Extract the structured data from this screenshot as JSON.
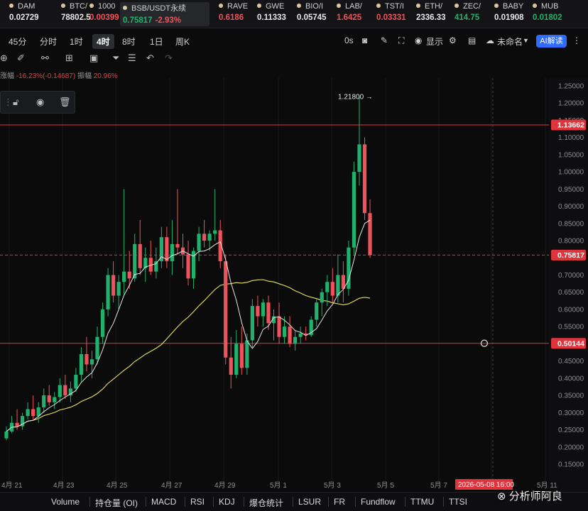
{
  "ticker": [
    {
      "name": "DAM",
      "price": "0.02729",
      "color": "w"
    },
    {
      "name": "BTC/",
      "price": "78802.5",
      "color": "w"
    },
    {
      "name": "1000",
      "price": "0.00399",
      "color": "r"
    },
    {
      "name": "BSB/USDT永续",
      "price": "0.75817",
      "change": "-2.93%",
      "color": "g",
      "active": true
    },
    {
      "name": "RAVE",
      "price": "0.6186",
      "color": "r"
    },
    {
      "name": "GWE",
      "price": "0.11333",
      "color": "w"
    },
    {
      "name": "BIO/I",
      "price": "0.05745",
      "color": "w"
    },
    {
      "name": "LAB/",
      "price": "1.6425",
      "color": "r"
    },
    {
      "name": "TST/I",
      "price": "0.03331",
      "color": "r"
    },
    {
      "name": "ETH/",
      "price": "2336.33",
      "color": "w"
    },
    {
      "name": "ZEC/",
      "price": "414.75",
      "color": "g"
    },
    {
      "name": "BABY",
      "price": "0.01908",
      "color": "w"
    },
    {
      "name": "MUB",
      "price": "0.01802",
      "color": "g"
    }
  ],
  "timeframes": [
    "45分",
    "分时",
    "1时",
    "4时",
    "8时",
    "1日",
    "周K"
  ],
  "active_timeframe": "4时",
  "toolbar": {
    "zero_label": "0s",
    "display_label": "显示",
    "layout_name": "未命名",
    "ai_label": "AI解读"
  },
  "stats": {
    "change_label": "涨幅",
    "change_value": "-16.23%(-0.14687)",
    "amp_label": "振幅",
    "amp_value": "20.96%"
  },
  "indicators": [
    "Volume",
    "持仓量 (OI)",
    "MACD",
    "RSI",
    "KDJ",
    "爆仓统计",
    "LSUR",
    "FR",
    "Fundflow",
    "TTMU",
    "TTSI"
  ],
  "watermark": "⊗ 分析师阿良",
  "colors": {
    "up": "#20b26c",
    "down": "#f0525a",
    "ma_short": "#e6e6e6",
    "ma_long": "#e8e25a",
    "hline": "#e0343c",
    "ai": "#2f6bff"
  },
  "chart_data": {
    "type": "candlestick",
    "interval": "4h",
    "ylim": [
      0.15,
      1.27
    ],
    "y_ticks": [
      1.25,
      1.2,
      1.15,
      1.1,
      1.05,
      1.0,
      0.95,
      0.9,
      0.85,
      0.8,
      0.75,
      0.7,
      0.65,
      0.6,
      0.55,
      0.5,
      0.45,
      0.4,
      0.35,
      0.3,
      0.25,
      0.2,
      0.15
    ],
    "x_labels": [
      "4月 21",
      "4月 23",
      "4月 25",
      "4月 27",
      "4月 29",
      "5月 1",
      "5月 3",
      "5月 5",
      "5月 7",
      "5月 11"
    ],
    "cursor_label": "2026-05-08 16:00",
    "price_lines": [
      {
        "value": 1.13662,
        "label": "1.13662",
        "style": "solid"
      },
      {
        "value": 0.75817,
        "label": "0.75817",
        "style": "dashed"
      },
      {
        "value": 0.50144,
        "label": "0.50144",
        "style": "solid"
      }
    ],
    "high_marker": {
      "value": 1.218,
      "label": "1.21800 →"
    },
    "candles": [
      [
        0.225,
        0.26,
        0.22,
        0.245
      ],
      [
        0.245,
        0.29,
        0.24,
        0.27
      ],
      [
        0.27,
        0.31,
        0.25,
        0.26
      ],
      [
        0.26,
        0.3,
        0.25,
        0.29
      ],
      [
        0.29,
        0.33,
        0.28,
        0.31
      ],
      [
        0.31,
        0.35,
        0.28,
        0.29
      ],
      [
        0.29,
        0.33,
        0.27,
        0.315
      ],
      [
        0.315,
        0.37,
        0.3,
        0.35
      ],
      [
        0.35,
        0.38,
        0.32,
        0.33
      ],
      [
        0.33,
        0.36,
        0.31,
        0.345
      ],
      [
        0.345,
        0.4,
        0.33,
        0.38
      ],
      [
        0.38,
        0.41,
        0.34,
        0.35
      ],
      [
        0.35,
        0.39,
        0.33,
        0.37
      ],
      [
        0.37,
        0.43,
        0.36,
        0.41
      ],
      [
        0.41,
        0.49,
        0.39,
        0.47
      ],
      [
        0.47,
        0.52,
        0.42,
        0.44
      ],
      [
        0.44,
        0.48,
        0.4,
        0.455
      ],
      [
        0.455,
        0.55,
        0.44,
        0.52
      ],
      [
        0.52,
        0.62,
        0.5,
        0.6
      ],
      [
        0.6,
        0.72,
        0.58,
        0.7
      ],
      [
        0.7,
        0.74,
        0.62,
        0.64
      ],
      [
        0.64,
        0.7,
        0.6,
        0.68
      ],
      [
        0.68,
        0.95,
        0.64,
        0.71
      ],
      [
        0.71,
        0.77,
        0.66,
        0.69
      ],
      [
        0.69,
        0.82,
        0.68,
        0.79
      ],
      [
        0.79,
        0.86,
        0.7,
        0.72
      ],
      [
        0.72,
        0.78,
        0.68,
        0.75
      ],
      [
        0.75,
        0.8,
        0.7,
        0.71
      ],
      [
        0.71,
        0.78,
        0.69,
        0.74
      ],
      [
        0.74,
        0.84,
        0.72,
        0.81
      ],
      [
        0.81,
        0.84,
        0.72,
        0.74
      ],
      [
        0.74,
        0.86,
        0.7,
        0.79
      ],
      [
        0.79,
        0.95,
        0.76,
        0.78
      ],
      [
        0.78,
        0.82,
        0.72,
        0.76
      ],
      [
        0.76,
        0.8,
        0.67,
        0.69
      ],
      [
        0.69,
        0.78,
        0.66,
        0.77
      ],
      [
        0.77,
        0.84,
        0.74,
        0.82
      ],
      [
        0.82,
        0.86,
        0.78,
        0.8
      ],
      [
        0.8,
        0.83,
        0.77,
        0.82
      ],
      [
        0.82,
        0.95,
        0.8,
        0.83
      ],
      [
        0.83,
        0.86,
        0.72,
        0.74
      ],
      [
        0.74,
        0.76,
        0.44,
        0.46
      ],
      [
        0.46,
        0.52,
        0.37,
        0.41
      ],
      [
        0.41,
        0.54,
        0.4,
        0.5
      ],
      [
        0.5,
        0.55,
        0.41,
        0.43
      ],
      [
        0.43,
        0.53,
        0.41,
        0.51
      ],
      [
        0.51,
        0.63,
        0.49,
        0.61
      ],
      [
        0.61,
        0.64,
        0.55,
        0.58
      ],
      [
        0.58,
        0.63,
        0.55,
        0.62
      ],
      [
        0.62,
        0.64,
        0.54,
        0.56
      ],
      [
        0.56,
        0.6,
        0.51,
        0.58
      ],
      [
        0.58,
        0.62,
        0.5,
        0.52
      ],
      [
        0.52,
        0.58,
        0.5,
        0.55
      ],
      [
        0.55,
        0.58,
        0.49,
        0.5
      ],
      [
        0.5,
        0.54,
        0.48,
        0.52
      ],
      [
        0.52,
        0.55,
        0.5,
        0.53
      ],
      [
        0.53,
        0.55,
        0.51,
        0.525
      ],
      [
        0.525,
        0.58,
        0.52,
        0.57
      ],
      [
        0.57,
        0.63,
        0.55,
        0.62
      ],
      [
        0.62,
        0.66,
        0.58,
        0.65
      ],
      [
        0.65,
        0.7,
        0.61,
        0.68
      ],
      [
        0.68,
        0.72,
        0.62,
        0.64
      ],
      [
        0.64,
        0.76,
        0.62,
        0.7
      ],
      [
        0.7,
        0.74,
        0.62,
        0.66
      ],
      [
        0.66,
        0.8,
        0.64,
        0.78
      ],
      [
        0.78,
        1.03,
        0.76,
        1.0
      ],
      [
        1.0,
        1.218,
        0.96,
        1.08
      ],
      [
        1.08,
        1.1,
        0.86,
        0.88
      ],
      [
        0.88,
        0.92,
        0.75,
        0.758
      ]
    ]
  }
}
